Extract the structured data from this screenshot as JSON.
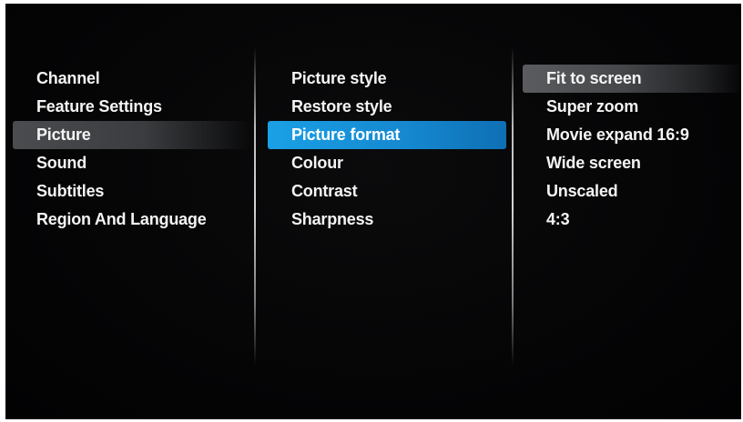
{
  "menu": {
    "column1": {
      "items": [
        {
          "label": "Channel"
        },
        {
          "label": "Feature Settings"
        },
        {
          "label": "Picture"
        },
        {
          "label": "Sound"
        },
        {
          "label": "Subtitles"
        },
        {
          "label": "Region And Language"
        }
      ],
      "selected_index": 2
    },
    "column2": {
      "items": [
        {
          "label": "Picture style"
        },
        {
          "label": "Restore style"
        },
        {
          "label": "Picture format"
        },
        {
          "label": "Colour"
        },
        {
          "label": "Contrast"
        },
        {
          "label": "Sharpness"
        }
      ],
      "highlighted_index": 2
    },
    "column3": {
      "items": [
        {
          "label": "Fit to screen"
        },
        {
          "label": "Super zoom"
        },
        {
          "label": "Movie expand 16:9"
        },
        {
          "label": "Wide screen"
        },
        {
          "label": "Unscaled"
        },
        {
          "label": "4:3"
        }
      ],
      "current_index": 0
    }
  },
  "colors": {
    "background": "#050506",
    "text": "#f4f4f4",
    "highlight_blue": "#1a8fd8",
    "selection_grey": "#4a4c4f"
  }
}
